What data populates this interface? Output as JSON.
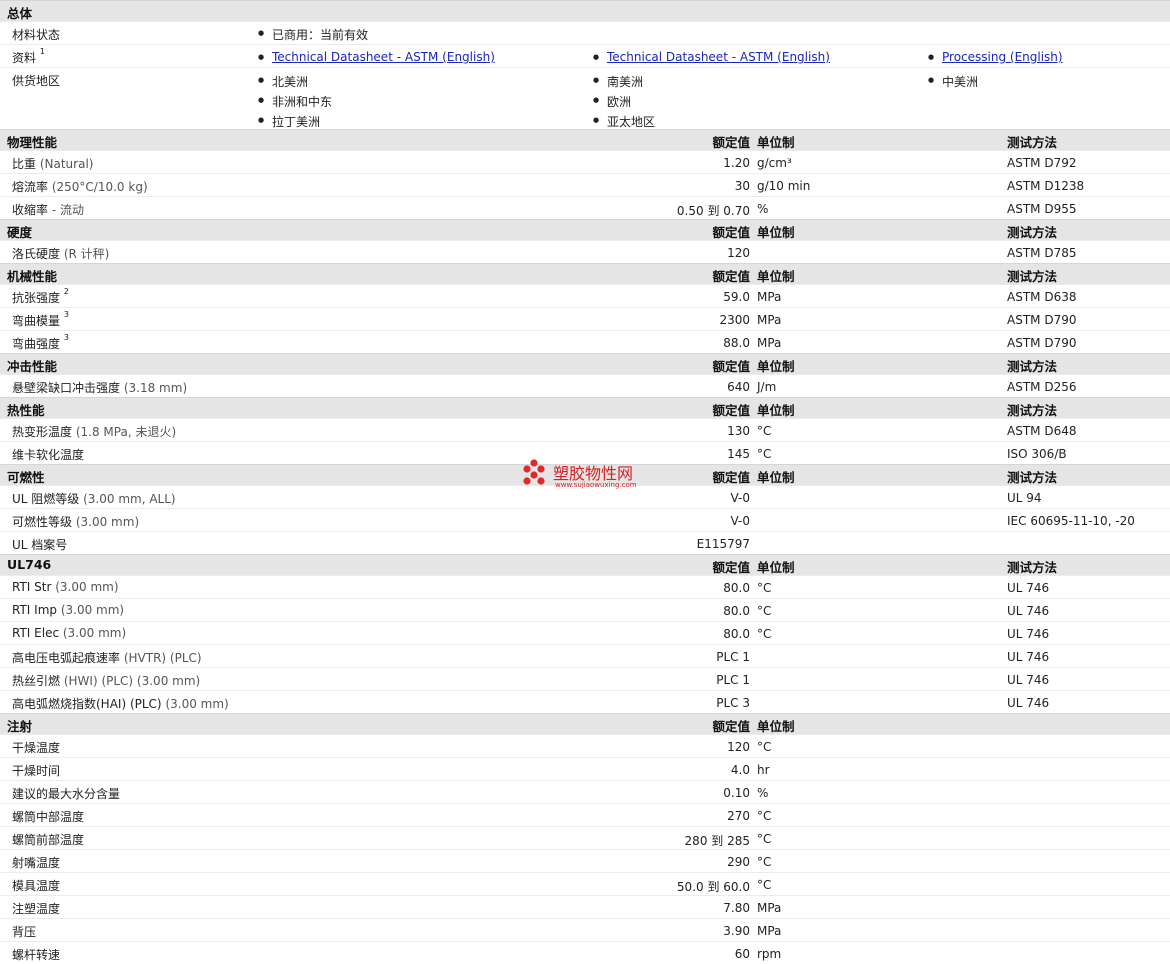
{
  "general": {
    "title": "总体",
    "status_label": "材料状态",
    "status_value": "已商用：当前有效",
    "docs_label": "资料",
    "docs_sup": "1",
    "docs": [
      "Technical Datasheet - ASTM (English)",
      "Technical Datasheet - ASTM (English)",
      "Processing (English)"
    ],
    "regions_label": "供货地区",
    "regions_col1": [
      "北美洲",
      "非洲和中东",
      "拉丁美洲"
    ],
    "regions_col2": [
      "南美洲",
      "欧洲",
      "亚太地区"
    ],
    "regions_col3": [
      "中美洲"
    ]
  },
  "headers": {
    "value": "额定值",
    "unit": "单位制",
    "method": "测试方法"
  },
  "sections": [
    {
      "title": "物理性能",
      "rows": [
        {
          "label": "比重",
          "cond": "(Natural)",
          "value": "1.20",
          "unit": "g/cm³",
          "method": "ASTM D792"
        },
        {
          "label": "熔流率",
          "cond": "(250°C/10.0 kg)",
          "value": "30",
          "unit": "g/10 min",
          "method": "ASTM D1238"
        },
        {
          "label": "收缩率",
          "cond": "- 流动",
          "value": "0.50 到  0.70",
          "unit": "%",
          "method": "ASTM D955"
        }
      ]
    },
    {
      "title": "硬度",
      "rows": [
        {
          "label": "洛氏硬度",
          "cond": "(R 计秤)",
          "value": "120",
          "unit": "",
          "method": "ASTM D785"
        }
      ]
    },
    {
      "title": "机械性能",
      "rows": [
        {
          "label": "抗张强度",
          "sup": "2",
          "value": "59.0",
          "unit": "MPa",
          "method": "ASTM D638"
        },
        {
          "label": "弯曲模量",
          "sup": "3",
          "value": "2300",
          "unit": "MPa",
          "method": "ASTM D790"
        },
        {
          "label": "弯曲强度",
          "sup": "3",
          "value": "88.0",
          "unit": "MPa",
          "method": "ASTM D790"
        }
      ]
    },
    {
      "title": "冲击性能",
      "rows": [
        {
          "label": "悬壁梁缺口冲击强度",
          "cond": "(3.18 mm)",
          "value": "640",
          "unit": "J/m",
          "method": "ASTM D256"
        }
      ]
    },
    {
      "title": "热性能",
      "rows": [
        {
          "label": "热变形温度",
          "cond": "(1.8 MPa, 未退火)",
          "value": "130",
          "unit": "°C",
          "method": "ASTM D648"
        },
        {
          "label": "维卡软化温度",
          "value": "145",
          "unit": "°C",
          "method": "ISO 306/B"
        }
      ]
    },
    {
      "title": "可燃性",
      "rows": [
        {
          "label": "UL 阻燃等级",
          "cond": "(3.00 mm, ALL)",
          "value": "V-0",
          "unit": "",
          "method": "UL 94"
        },
        {
          "label": "可燃性等级",
          "cond": "(3.00 mm)",
          "value": "V-0",
          "unit": "",
          "method": "IEC 60695-11-10, -20"
        },
        {
          "label": "UL 档案号",
          "value": "E115797",
          "unit": "",
          "method": ""
        }
      ]
    },
    {
      "title": "UL746",
      "rows": [
        {
          "label": "RTI Str",
          "cond": "(3.00 mm)",
          "value": "80.0",
          "unit": "°C",
          "method": "UL 746"
        },
        {
          "label": "RTI Imp",
          "cond": "(3.00 mm)",
          "value": "80.0",
          "unit": "°C",
          "method": "UL 746"
        },
        {
          "label": "RTI Elec",
          "cond": "(3.00 mm)",
          "value": "80.0",
          "unit": "°C",
          "method": "UL 746"
        },
        {
          "label": "高电压电弧起痕速率",
          "cond": "(HVTR) (PLC)",
          "value": "PLC 1",
          "unit": "",
          "method": "UL 746"
        },
        {
          "label": "热丝引燃",
          "cond": "(HWI) (PLC) (3.00 mm)",
          "value": "PLC 1",
          "unit": "",
          "method": "UL 746"
        },
        {
          "label": "高电弧燃烧指数(HAI) (PLC)",
          "cond": "(3.00 mm)",
          "value": "PLC 3",
          "unit": "",
          "method": "UL 746"
        }
      ]
    },
    {
      "title": "注射",
      "no_method": true,
      "rows": [
        {
          "label": "干燥温度",
          "value": "120",
          "unit": "°C"
        },
        {
          "label": "干燥时间",
          "value": "4.0",
          "unit": "hr"
        },
        {
          "label": "建议的最大水分含量",
          "value": "0.10",
          "unit": "%"
        },
        {
          "label": "螺筒中部温度",
          "value": "270",
          "unit": "°C"
        },
        {
          "label": "螺筒前部温度",
          "value": "280 到  285",
          "unit": "°C"
        },
        {
          "label": "射嘴温度",
          "value": "290",
          "unit": "°C"
        },
        {
          "label": "模具温度",
          "value": "50.0 到  60.0",
          "unit": "°C"
        },
        {
          "label": "注塑温度",
          "value": "7.80",
          "unit": "MPa"
        },
        {
          "label": "背压",
          "value": "3.90",
          "unit": "MPa"
        },
        {
          "label": "螺杆转速",
          "value": "60",
          "unit": "rpm"
        }
      ]
    }
  ],
  "watermark": {
    "name": "塑胶物性网",
    "url": "www.sujiaowuxing.com"
  }
}
